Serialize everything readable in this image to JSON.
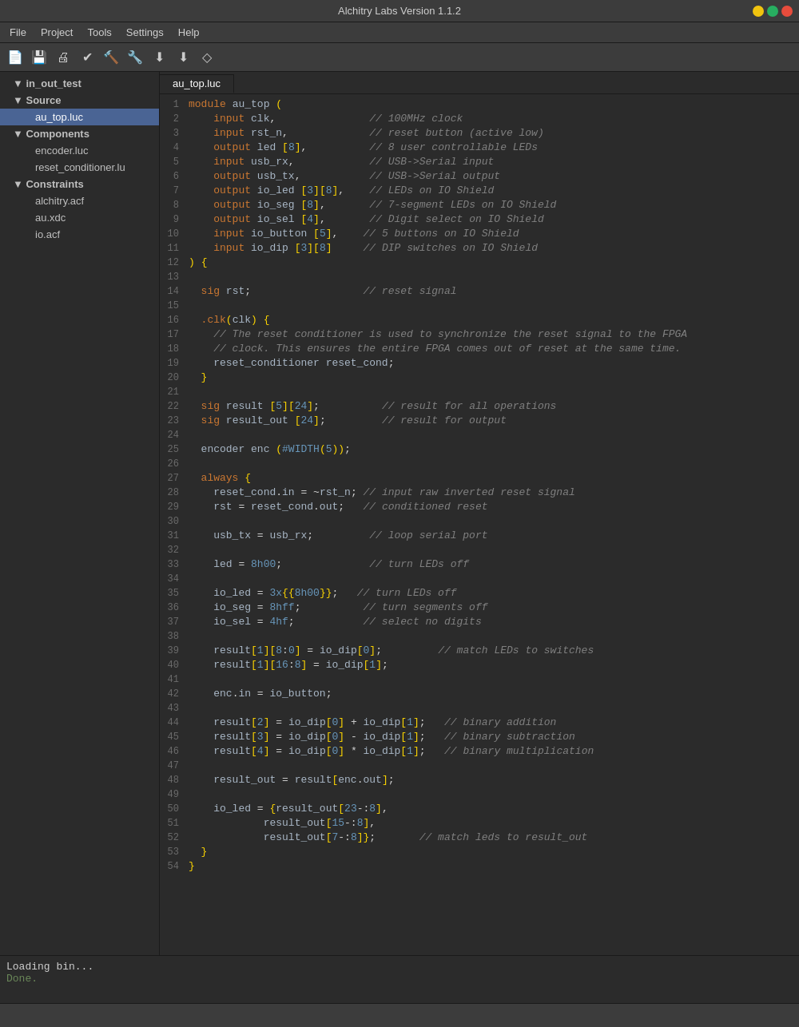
{
  "titlebar": {
    "title": "Alchitry Labs Version 1.1.2"
  },
  "menubar": {
    "items": [
      "File",
      "Project",
      "Tools",
      "Settings",
      "Help"
    ]
  },
  "toolbar": {
    "buttons": [
      {
        "name": "new-file-button",
        "icon": "📄"
      },
      {
        "name": "save-button",
        "icon": "💾"
      },
      {
        "name": "print-button",
        "icon": "🖨"
      },
      {
        "name": "check-button",
        "icon": "✔"
      },
      {
        "name": "build-button",
        "icon": "🔨"
      },
      {
        "name": "build-debug-button",
        "icon": "🔧"
      },
      {
        "name": "download-button",
        "icon": "⬇"
      },
      {
        "name": "download2-button",
        "icon": "⬇"
      },
      {
        "name": "clear-button",
        "icon": "◇"
      }
    ]
  },
  "sidebar": {
    "project": "in_out_test",
    "items": [
      {
        "label": "▼ in_out_test",
        "level": 0,
        "type": "project"
      },
      {
        "label": "▼ Source",
        "level": 1,
        "type": "folder"
      },
      {
        "label": "au_top.luc",
        "level": 2,
        "type": "file",
        "active": true
      },
      {
        "label": "▼ Components",
        "level": 1,
        "type": "folder"
      },
      {
        "label": "encoder.luc",
        "level": 2,
        "type": "file"
      },
      {
        "label": "reset_conditioner.lu",
        "level": 2,
        "type": "file"
      },
      {
        "label": "▼ Constraints",
        "level": 1,
        "type": "folder"
      },
      {
        "label": "alchitry.acf",
        "level": 2,
        "type": "file"
      },
      {
        "label": "au.xdc",
        "level": 2,
        "type": "file"
      },
      {
        "label": "io.acf",
        "level": 2,
        "type": "file"
      }
    ]
  },
  "tab": {
    "label": "au_top.luc"
  },
  "status": {
    "loading": "Loading bin...",
    "done": "Done."
  },
  "code": {
    "lines": 54
  }
}
